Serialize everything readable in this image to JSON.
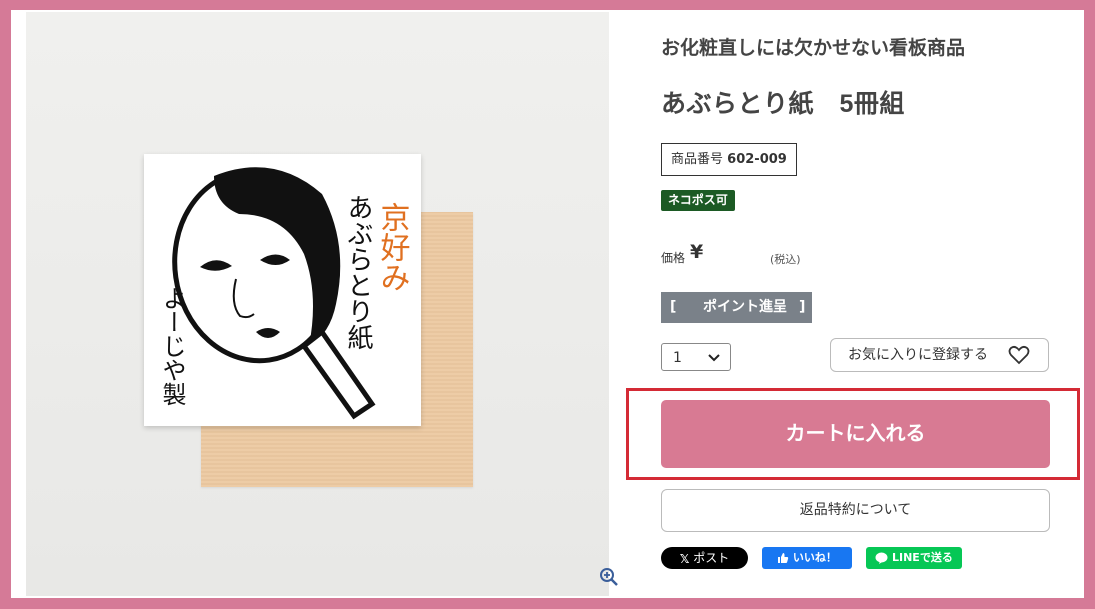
{
  "product": {
    "subtitle": "お化粧直しには欠かせない看板商品",
    "title": "あぶらとり紙　5冊組",
    "sku_label": "商品番号",
    "sku_value": "602-009",
    "shipping_badge": "ネコポス可",
    "price_label": "価格",
    "price_symbol": "¥",
    "tax_note": "(税込)"
  },
  "image": {
    "package_text_orange": "京好み",
    "package_text_black": "あぶらとり紙",
    "brand_text": "よーじや製",
    "zoom_icon": "zoom-in-icon"
  },
  "points": {
    "open": "[",
    "label": "ポイント進呈",
    "close": "]"
  },
  "quantity": {
    "selected": "1"
  },
  "actions": {
    "favorite_label": "お気に入りに登録する",
    "cart_label": "カートに入れる",
    "returns_label": "返品特約について"
  },
  "share": {
    "x_label": "ポスト",
    "fb_label": "いいね！",
    "line_label": "LINEで送る"
  },
  "colors": {
    "frame": "#d57a97",
    "cart_button": "#d87a93",
    "highlight": "#d42a35",
    "badge": "#1c5a24",
    "points_bar": "#7a8189"
  }
}
